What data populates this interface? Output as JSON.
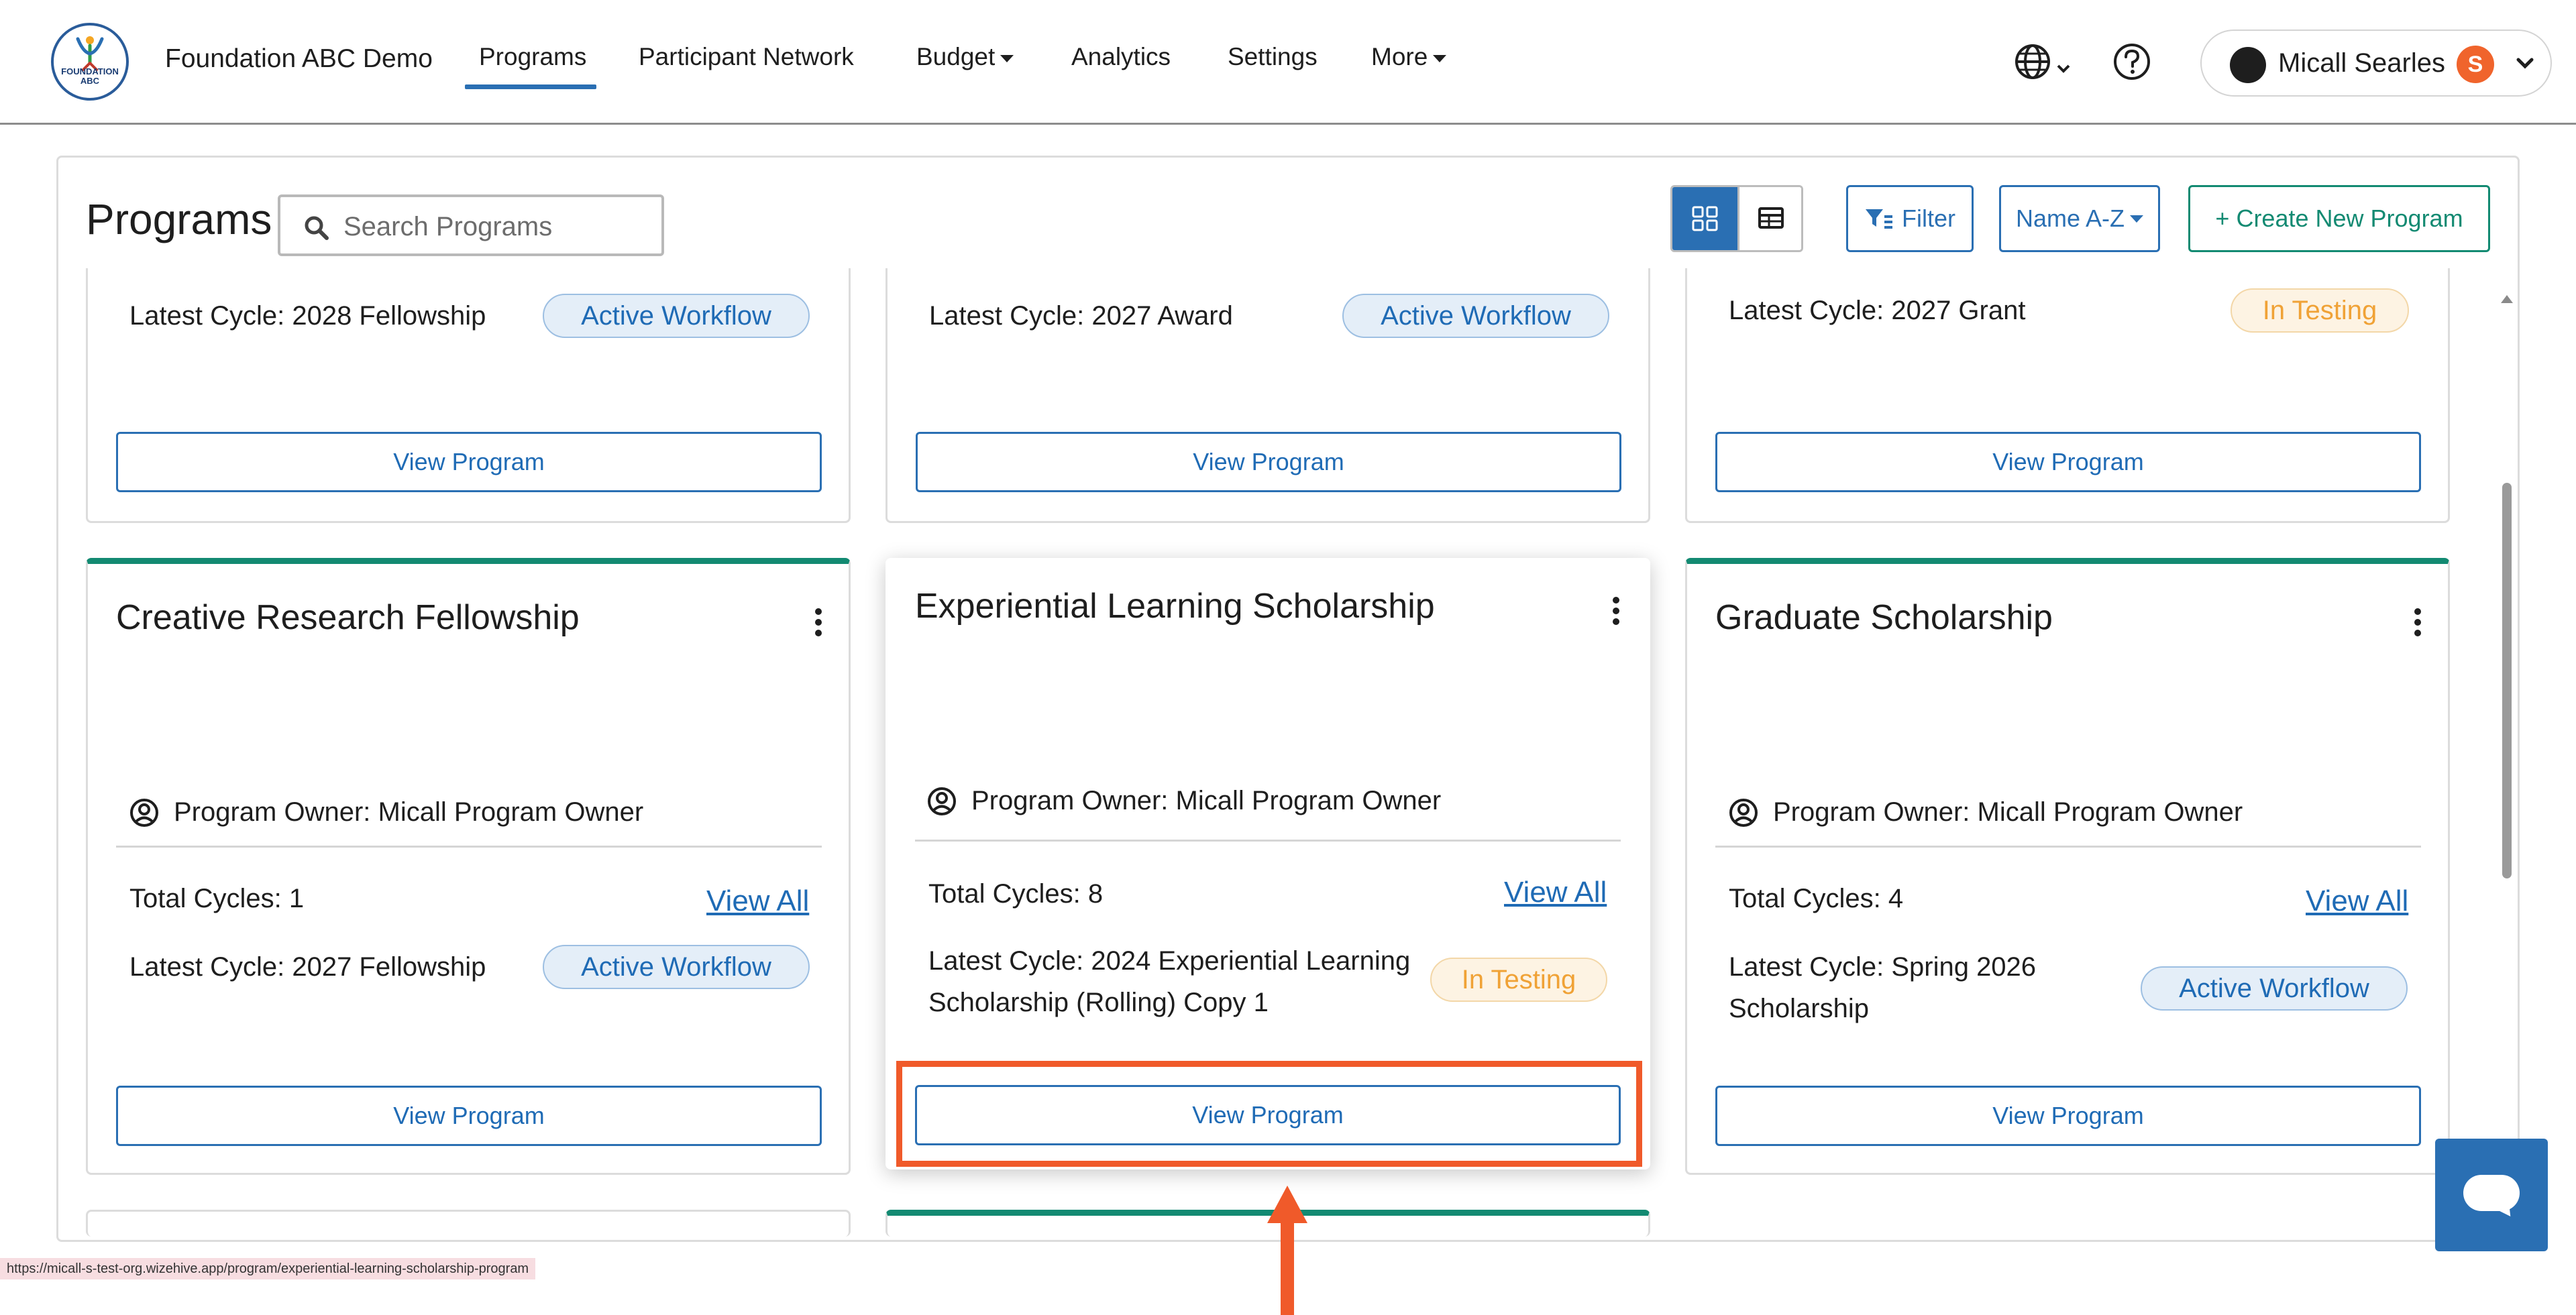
{
  "header": {
    "logo_text": "FOUNDATION ABC",
    "org_name": "Foundation ABC Demo",
    "nav": [
      {
        "label": "Programs"
      },
      {
        "label": "Participant Network"
      },
      {
        "label": "Budget"
      },
      {
        "label": "Analytics"
      },
      {
        "label": "Settings"
      },
      {
        "label": "More"
      }
    ],
    "user": {
      "name": "Micall Searles",
      "badge": "S"
    }
  },
  "toolbar": {
    "title": "Programs",
    "search_placeholder": "Search Programs",
    "filter_label": "Filter",
    "sort_label": "Name A-Z",
    "create_label": "+ Create New Program"
  },
  "cards_top": [
    {
      "latest_cycle": "Latest Cycle: 2028 Fellowship",
      "status": "Active Workflow",
      "view_label": "View Program"
    },
    {
      "latest_cycle": "Latest Cycle: 2027 Award",
      "status": "Active Workflow",
      "view_label": "View Program"
    },
    {
      "latest_cycle": "Latest Cycle: 2027 Grant",
      "status": "In Testing",
      "view_label": "View Program"
    }
  ],
  "cards": [
    {
      "title": "Creative Research Fellowship",
      "owner": "Program Owner: Micall Program Owner",
      "total_cycles": "Total Cycles: 1",
      "view_all": "View All",
      "latest_cycle_line1": "Latest Cycle: 2027 Fellowship",
      "latest_cycle_line2": "",
      "status": "Active Workflow",
      "view_label": "View Program"
    },
    {
      "title": "Experiential Learning Scholarship",
      "owner": "Program Owner: Micall Program Owner",
      "total_cycles": "Total Cycles: 8",
      "view_all": "View All",
      "latest_cycle_line1": "Latest Cycle: 2024 Experiential Learning",
      "latest_cycle_line2": "Scholarship (Rolling) Copy 1",
      "status": "In Testing",
      "view_label": "View Program"
    },
    {
      "title": "Graduate Scholarship",
      "owner": "Program Owner: Micall Program Owner",
      "total_cycles": "Total Cycles: 4",
      "view_all": "View All",
      "latest_cycle_line1": "Latest Cycle: Spring 2026",
      "latest_cycle_line2": "Scholarship",
      "status": "Active Workflow",
      "view_label": "View Program"
    }
  ],
  "status_bar_url": "https://micall-s-test-org.wizehive.app/program/experiential-learning-scholarship-program",
  "colors": {
    "primary": "#2a6fb3",
    "accent_green": "#138a72",
    "highlight": "#f05a2a",
    "testing": "#f0a236"
  },
  "icons": [
    "globe-icon",
    "help-icon",
    "search-icon",
    "grid-view-icon",
    "table-view-icon",
    "filter-icon",
    "user-circle-icon",
    "kebab-menu-icon",
    "chat-icon"
  ]
}
